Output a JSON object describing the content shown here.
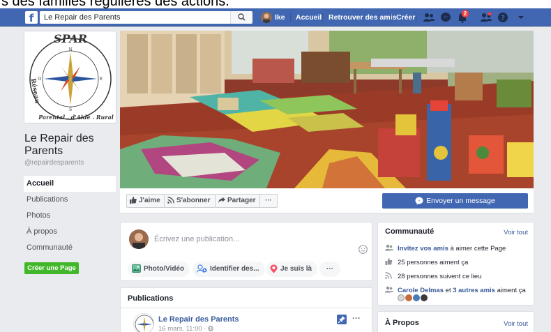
{
  "caption": {
    "text": "s des familles régulières des actions."
  },
  "header": {
    "search_value": "Le Repair des Parents",
    "user_name": "Ike",
    "nav": [
      "Accueil",
      "Retrouver des amis",
      "Créer"
    ],
    "notification_count": "2",
    "brand_color": "#4267b2"
  },
  "page": {
    "name": "Le Repair des Parents",
    "handle": "@repairdesparents",
    "logo_text": {
      "top": "SPAR",
      "left": "Réseau",
      "bottom": "Parental . d'Aide . Rural",
      "compass": [
        "N",
        "E",
        "S",
        "O"
      ]
    }
  },
  "leftnav": {
    "items": [
      "Accueil",
      "Publications",
      "Photos",
      "À propos",
      "Communauté"
    ],
    "create_page": "Créer une Page"
  },
  "actions": {
    "like": "J'aime",
    "follow": "S'abonner",
    "share": "Partager",
    "more": "···",
    "message": "Envoyer un message"
  },
  "composer": {
    "placeholder": "Écrivez une publication...",
    "chips": [
      "Photo/Vidéo",
      "Identifier des...",
      "Je suis là",
      "···"
    ]
  },
  "posts": {
    "title": "Publications",
    "author": "Le Repair des Parents",
    "time": "16 mars, 11:00 ·",
    "more": "···"
  },
  "community": {
    "title": "Communauté",
    "see_all": "Voir tout",
    "invite_link": "Invitez vos amis",
    "invite_rest": " à aimer cette Page",
    "likes": "25 personnes aiment ça",
    "followers": "28 personnes suivent ce lieu",
    "friend_name": "Carole Delmas",
    "friend_mid": " et ",
    "friend_others": "3 autres amis",
    "friend_rest": " aiment ça"
  },
  "about": {
    "title": "À Propos",
    "see_all": "Voir tout"
  }
}
